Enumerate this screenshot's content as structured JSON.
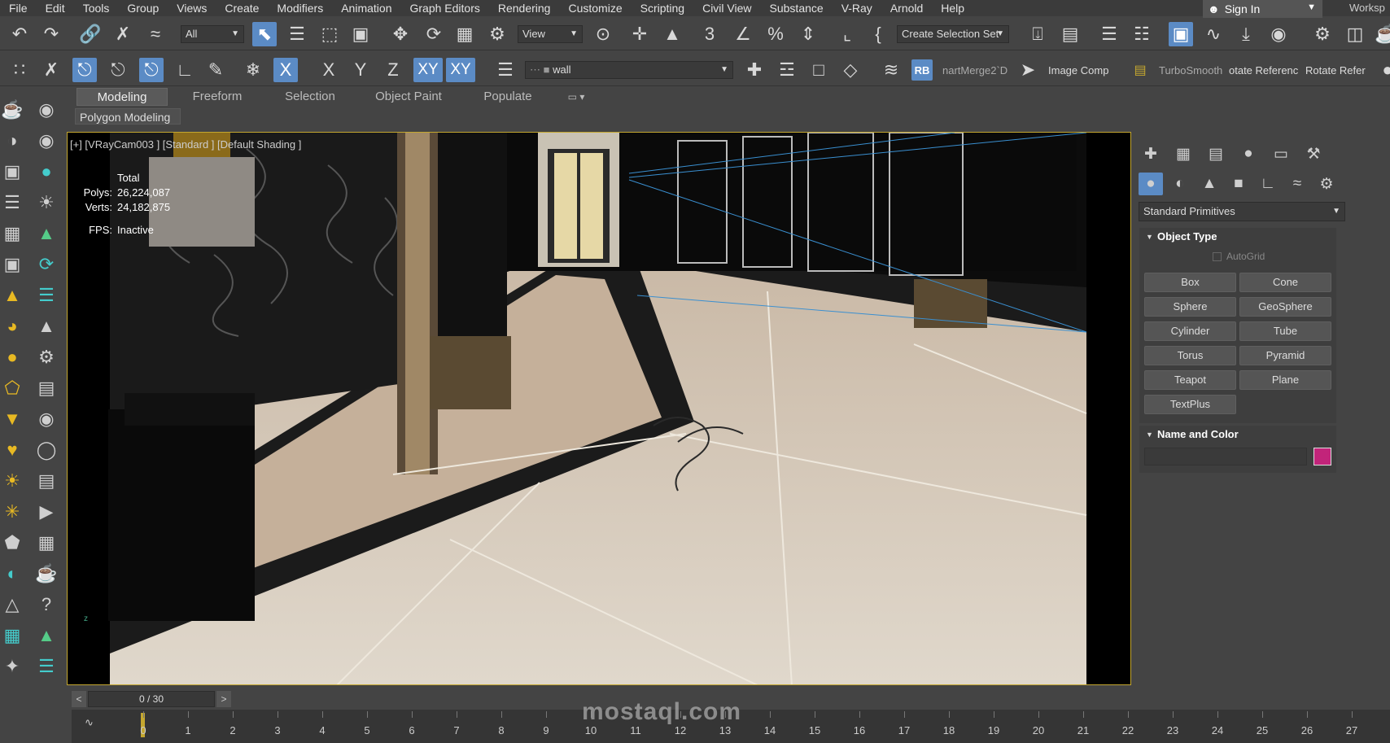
{
  "menubar": {
    "items": [
      "File",
      "Edit",
      "Tools",
      "Group",
      "Views",
      "Create",
      "Modifiers",
      "Animation",
      "Graph Editors",
      "Rendering",
      "Customize",
      "Scripting",
      "Civil View",
      "Substance",
      "V-Ray",
      "Arnold",
      "Help"
    ],
    "signin": "Sign In",
    "workspace": "Worksp"
  },
  "toolbar1": {
    "filter_value": "All",
    "view_value": "View",
    "selection_set_value": "Create Selection Set"
  },
  "toolbar2": {
    "axis_x": "X",
    "axis_y": "Y",
    "axis_z": "Z",
    "axis_xy": "XY",
    "axis_xy2": "XY",
    "layer_value": "wall",
    "rb_label": "RB",
    "smartmerge_label": "nartMerge2`D",
    "image_comp_label": "Image Comp",
    "turbosmooth_label": "TurboSmooth",
    "rotate_ref1_label": "otate Referenc",
    "rotate_ref2_label": "Rotate Refer"
  },
  "ribbon": {
    "tabs": [
      "Modeling",
      "Freeform",
      "Selection",
      "Object Paint",
      "Populate"
    ],
    "active_tab": "Modeling",
    "subtab": "Polygon Modeling"
  },
  "viewport": {
    "label": "[+] [VRayCam003 ] [Standard ] [Default Shading ]",
    "stats_header": "Total",
    "polys_label": "Polys:",
    "polys_value": "26,224,087",
    "verts_label": "Verts:",
    "verts_value": "24,182,875",
    "fps_label": "FPS:",
    "fps_value": "Inactive",
    "border_color": "#c4a72f"
  },
  "command_panel": {
    "category_value": "Standard Primitives",
    "object_type_title": "Object Type",
    "autogrid_label": "AutoGrid",
    "buttons": [
      "Box",
      "Cone",
      "Sphere",
      "GeoSphere",
      "Cylinder",
      "Tube",
      "Torus",
      "Pyramid",
      "Teapot",
      "Plane",
      "TextPlus"
    ],
    "name_color_title": "Name and Color",
    "object_color": "#c2247a"
  },
  "timeline": {
    "frame_display": "0 / 30",
    "prev_label": "<",
    "next_label": ">",
    "frame_numbers": [
      "0",
      "1",
      "2",
      "3",
      "4",
      "5",
      "6",
      "7",
      "8",
      "9",
      "10",
      "11",
      "12",
      "13",
      "14",
      "15",
      "16",
      "17",
      "18",
      "19",
      "20",
      "21",
      "22",
      "23",
      "24",
      "25",
      "26",
      "27"
    ]
  },
  "watermark": "mostaql.com"
}
